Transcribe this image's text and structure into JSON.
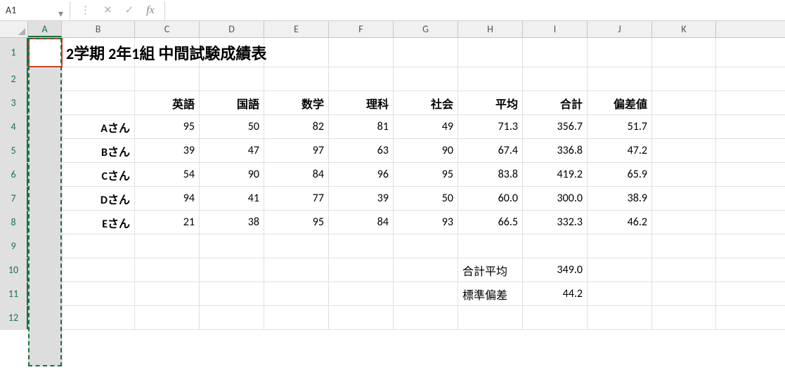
{
  "nameBox": "A1",
  "formulaValue": "",
  "columns": [
    "A",
    "B",
    "C",
    "D",
    "E",
    "F",
    "G",
    "H",
    "I",
    "J",
    "K"
  ],
  "activeColumn": "A",
  "rows": [
    "1",
    "2",
    "3",
    "4",
    "5",
    "6",
    "7",
    "8",
    "9",
    "10",
    "11",
    "12"
  ],
  "title": "2学期 2年1組 中間試験成績表",
  "headers": {
    "c": "英語",
    "d": "国語",
    "e": "数学",
    "f": "理科",
    "g": "社会",
    "h": "平均",
    "i": "合計",
    "j": "偏差値"
  },
  "students": [
    {
      "name": "Aさん",
      "c": "95",
      "d": "50",
      "e": "82",
      "f": "81",
      "g": "49",
      "h": "71.3",
      "i": "356.7",
      "j": "51.7"
    },
    {
      "name": "Bさん",
      "c": "39",
      "d": "47",
      "e": "97",
      "f": "63",
      "g": "90",
      "h": "67.4",
      "i": "336.8",
      "j": "47.2"
    },
    {
      "name": "Cさん",
      "c": "54",
      "d": "90",
      "e": "84",
      "f": "96",
      "g": "95",
      "h": "83.8",
      "i": "419.2",
      "j": "65.9"
    },
    {
      "name": "Dさん",
      "c": "94",
      "d": "41",
      "e": "77",
      "f": "39",
      "g": "50",
      "h": "60.0",
      "i": "300.0",
      "j": "38.9"
    },
    {
      "name": "Eさん",
      "c": "21",
      "d": "38",
      "e": "95",
      "f": "84",
      "g": "93",
      "h": "66.5",
      "i": "332.3",
      "j": "46.2"
    }
  ],
  "summary": {
    "avgLabel": "合計平均",
    "avgValue": "349.0",
    "stdLabel": "標準偏差",
    "stdValue": "44.2"
  },
  "chart_data": {
    "type": "table",
    "title": "2学期 2年1組 中間試験成績表",
    "columns": [
      "英語",
      "国語",
      "数学",
      "理科",
      "社会",
      "平均",
      "合計",
      "偏差値"
    ],
    "rows": [
      {
        "name": "Aさん",
        "values": [
          95,
          50,
          82,
          81,
          49,
          71.3,
          356.7,
          51.7
        ]
      },
      {
        "name": "Bさん",
        "values": [
          39,
          47,
          97,
          63,
          90,
          67.4,
          336.8,
          47.2
        ]
      },
      {
        "name": "Cさん",
        "values": [
          54,
          90,
          84,
          96,
          95,
          83.8,
          419.2,
          65.9
        ]
      },
      {
        "name": "Dさん",
        "values": [
          94,
          41,
          77,
          39,
          50,
          60.0,
          300.0,
          38.9
        ]
      },
      {
        "name": "Eさん",
        "values": [
          21,
          38,
          95,
          84,
          93,
          66.5,
          332.3,
          46.2
        ]
      }
    ],
    "summary": {
      "合計平均": 349.0,
      "標準偏差": 44.2
    }
  }
}
